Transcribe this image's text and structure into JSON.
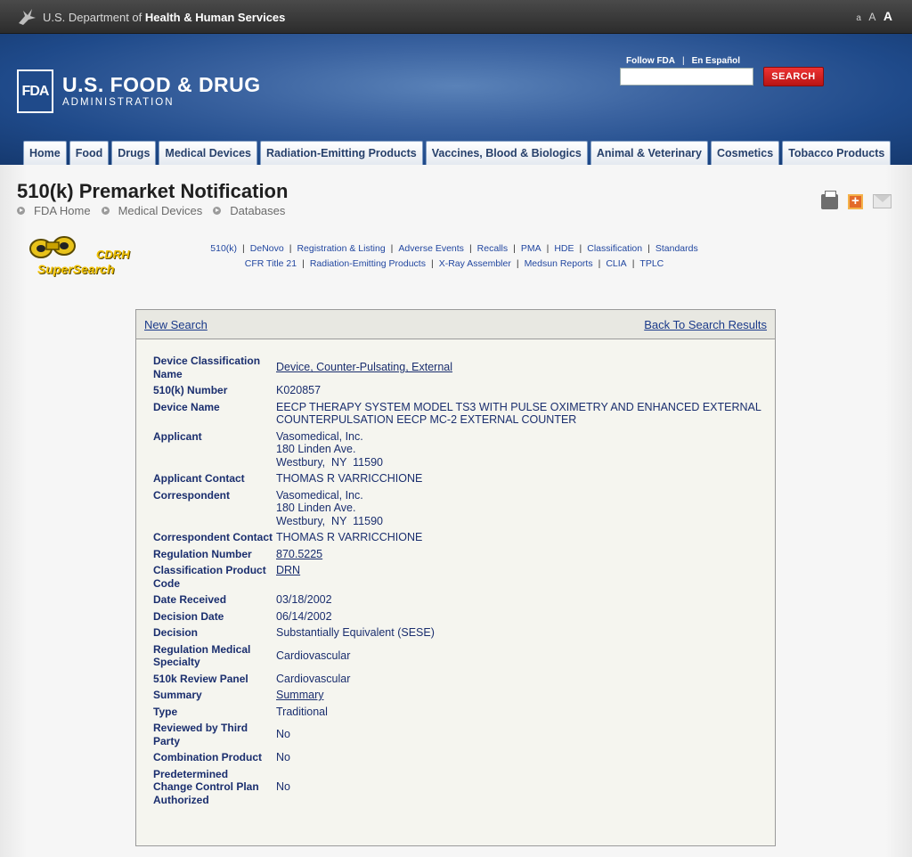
{
  "hhs": {
    "prefix": "U.S. Department of ",
    "bold": "Health & Human Services",
    "textsize": [
      "a",
      "A",
      "A"
    ]
  },
  "header": {
    "logo_mark": "FDA",
    "title": "U.S. FOOD & DRUG",
    "subtitle": "ADMINISTRATION",
    "follow": "Follow FDA",
    "espanol": "En Español",
    "search_value": "",
    "search_button": "SEARCH",
    "tabs": [
      "Home",
      "Food",
      "Drugs",
      "Medical Devices",
      "Radiation-Emitting Products",
      "Vaccines, Blood & Biologics",
      "Animal & Veterinary",
      "Cosmetics",
      "Tobacco Products"
    ]
  },
  "page": {
    "title": "510(k) Premarket Notification",
    "breadcrumbs": [
      "FDA Home",
      "Medical Devices",
      "Databases"
    ],
    "icons": [
      "print-icon",
      "plus-icon",
      "mail-icon"
    ]
  },
  "cdrh": {
    "line1": "CDRH",
    "line2": "SuperSearch"
  },
  "links_row1": [
    "510(k)",
    "DeNovo",
    "Registration & Listing",
    "Adverse Events",
    "Recalls",
    "PMA",
    "HDE",
    "Classification",
    "Standards"
  ],
  "links_row2": [
    "CFR Title 21",
    "Radiation-Emitting Products",
    "X-Ray Assembler",
    "Medsun Reports",
    "CLIA",
    "TPLC"
  ],
  "box": {
    "new_search": "New Search",
    "back": "Back To Search Results",
    "fields": [
      {
        "label": "Device Classification Name",
        "value": "Device, Counter-Pulsating, External",
        "link": true
      },
      {
        "label": "510(k) Number",
        "value": "K020857"
      },
      {
        "label": "Device Name",
        "value": "EECP THERAPY SYSTEM MODEL TS3 WITH PULSE OXIMETRY AND ENHANCED EXTERNAL COUNTERPULSATION EECP MC-2 EXTERNAL COUNTER"
      },
      {
        "label": "Applicant",
        "lines": [
          "Vasomedical, Inc.",
          "180 Linden Ave.",
          "Westbury,  NY  11590"
        ]
      },
      {
        "label": "Applicant Contact",
        "value": "THOMAS R VARRICCHIONE"
      },
      {
        "label": "Correspondent",
        "lines": [
          "Vasomedical, Inc.",
          "180 Linden Ave.",
          "Westbury,  NY  11590"
        ]
      },
      {
        "label": "Correspondent Contact",
        "value": "THOMAS R VARRICCHIONE"
      },
      {
        "label": "Regulation Number",
        "value": "870.5225",
        "link": true
      },
      {
        "label": "Classification Product Code",
        "value": "DRN",
        "link": true
      },
      {
        "label": "Date Received",
        "value": "03/18/2002"
      },
      {
        "label": "Decision Date",
        "value": "06/14/2002"
      },
      {
        "label": "Decision",
        "value": "Substantially Equivalent (SESE)"
      },
      {
        "label": "Regulation Medical Specialty",
        "value": "Cardiovascular"
      },
      {
        "label": "510k Review Panel",
        "value": "Cardiovascular"
      },
      {
        "label": "Summary",
        "value": "Summary",
        "link": true
      },
      {
        "label": "Type",
        "value": "Traditional"
      },
      {
        "label": "Reviewed by Third Party",
        "value": "No"
      },
      {
        "label": "Combination Product",
        "value": "No"
      },
      {
        "label": "Predetermined Change Control Plan Authorized",
        "value": "No"
      }
    ]
  },
  "colors": {
    "header_blue": "#1f4a8a",
    "search_red": "#cc1f1f",
    "link_blue": "#1a2e6e"
  }
}
